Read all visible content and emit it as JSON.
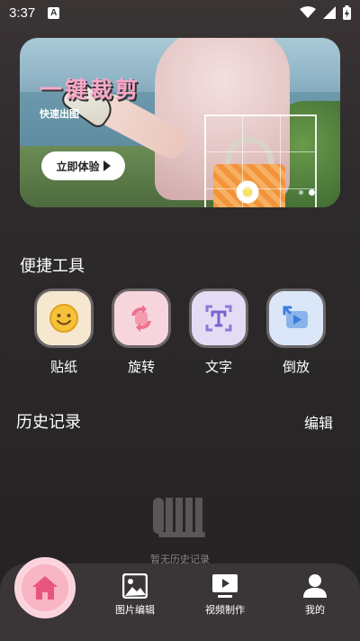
{
  "status_bar": {
    "time": "3:37",
    "notification_badge": "A"
  },
  "banner": {
    "title": "一键裁剪",
    "subtitle": "快速出图",
    "cta_label": "立即体验",
    "page_count": 2,
    "active_page": 2
  },
  "quick_tools": {
    "title": "便捷工具",
    "items": [
      {
        "label": "贴纸",
        "icon": "smiley-sticker-icon",
        "color": "#f6e7cf"
      },
      {
        "label": "旋转",
        "icon": "rotate-icon",
        "color": "#f7d5dc"
      },
      {
        "label": "文字",
        "icon": "text-icon",
        "color": "#e2dcf5"
      },
      {
        "label": "倒放",
        "icon": "reverse-play-icon",
        "color": "#dbe7f8"
      }
    ]
  },
  "history": {
    "title": "历史记录",
    "edit_label": "编辑",
    "empty_text": "暂无历史记录"
  },
  "bottom_nav": {
    "items": [
      {
        "label": "",
        "icon": "home-icon"
      },
      {
        "label": "图片编辑",
        "icon": "image-icon"
      },
      {
        "label": "视频制作",
        "icon": "video-icon"
      },
      {
        "label": "我的",
        "icon": "person-icon"
      }
    ]
  },
  "colors": {
    "accent_pink": "#f7a8c8",
    "background": "#2e2a2b",
    "nav_background": "#3a3638"
  }
}
